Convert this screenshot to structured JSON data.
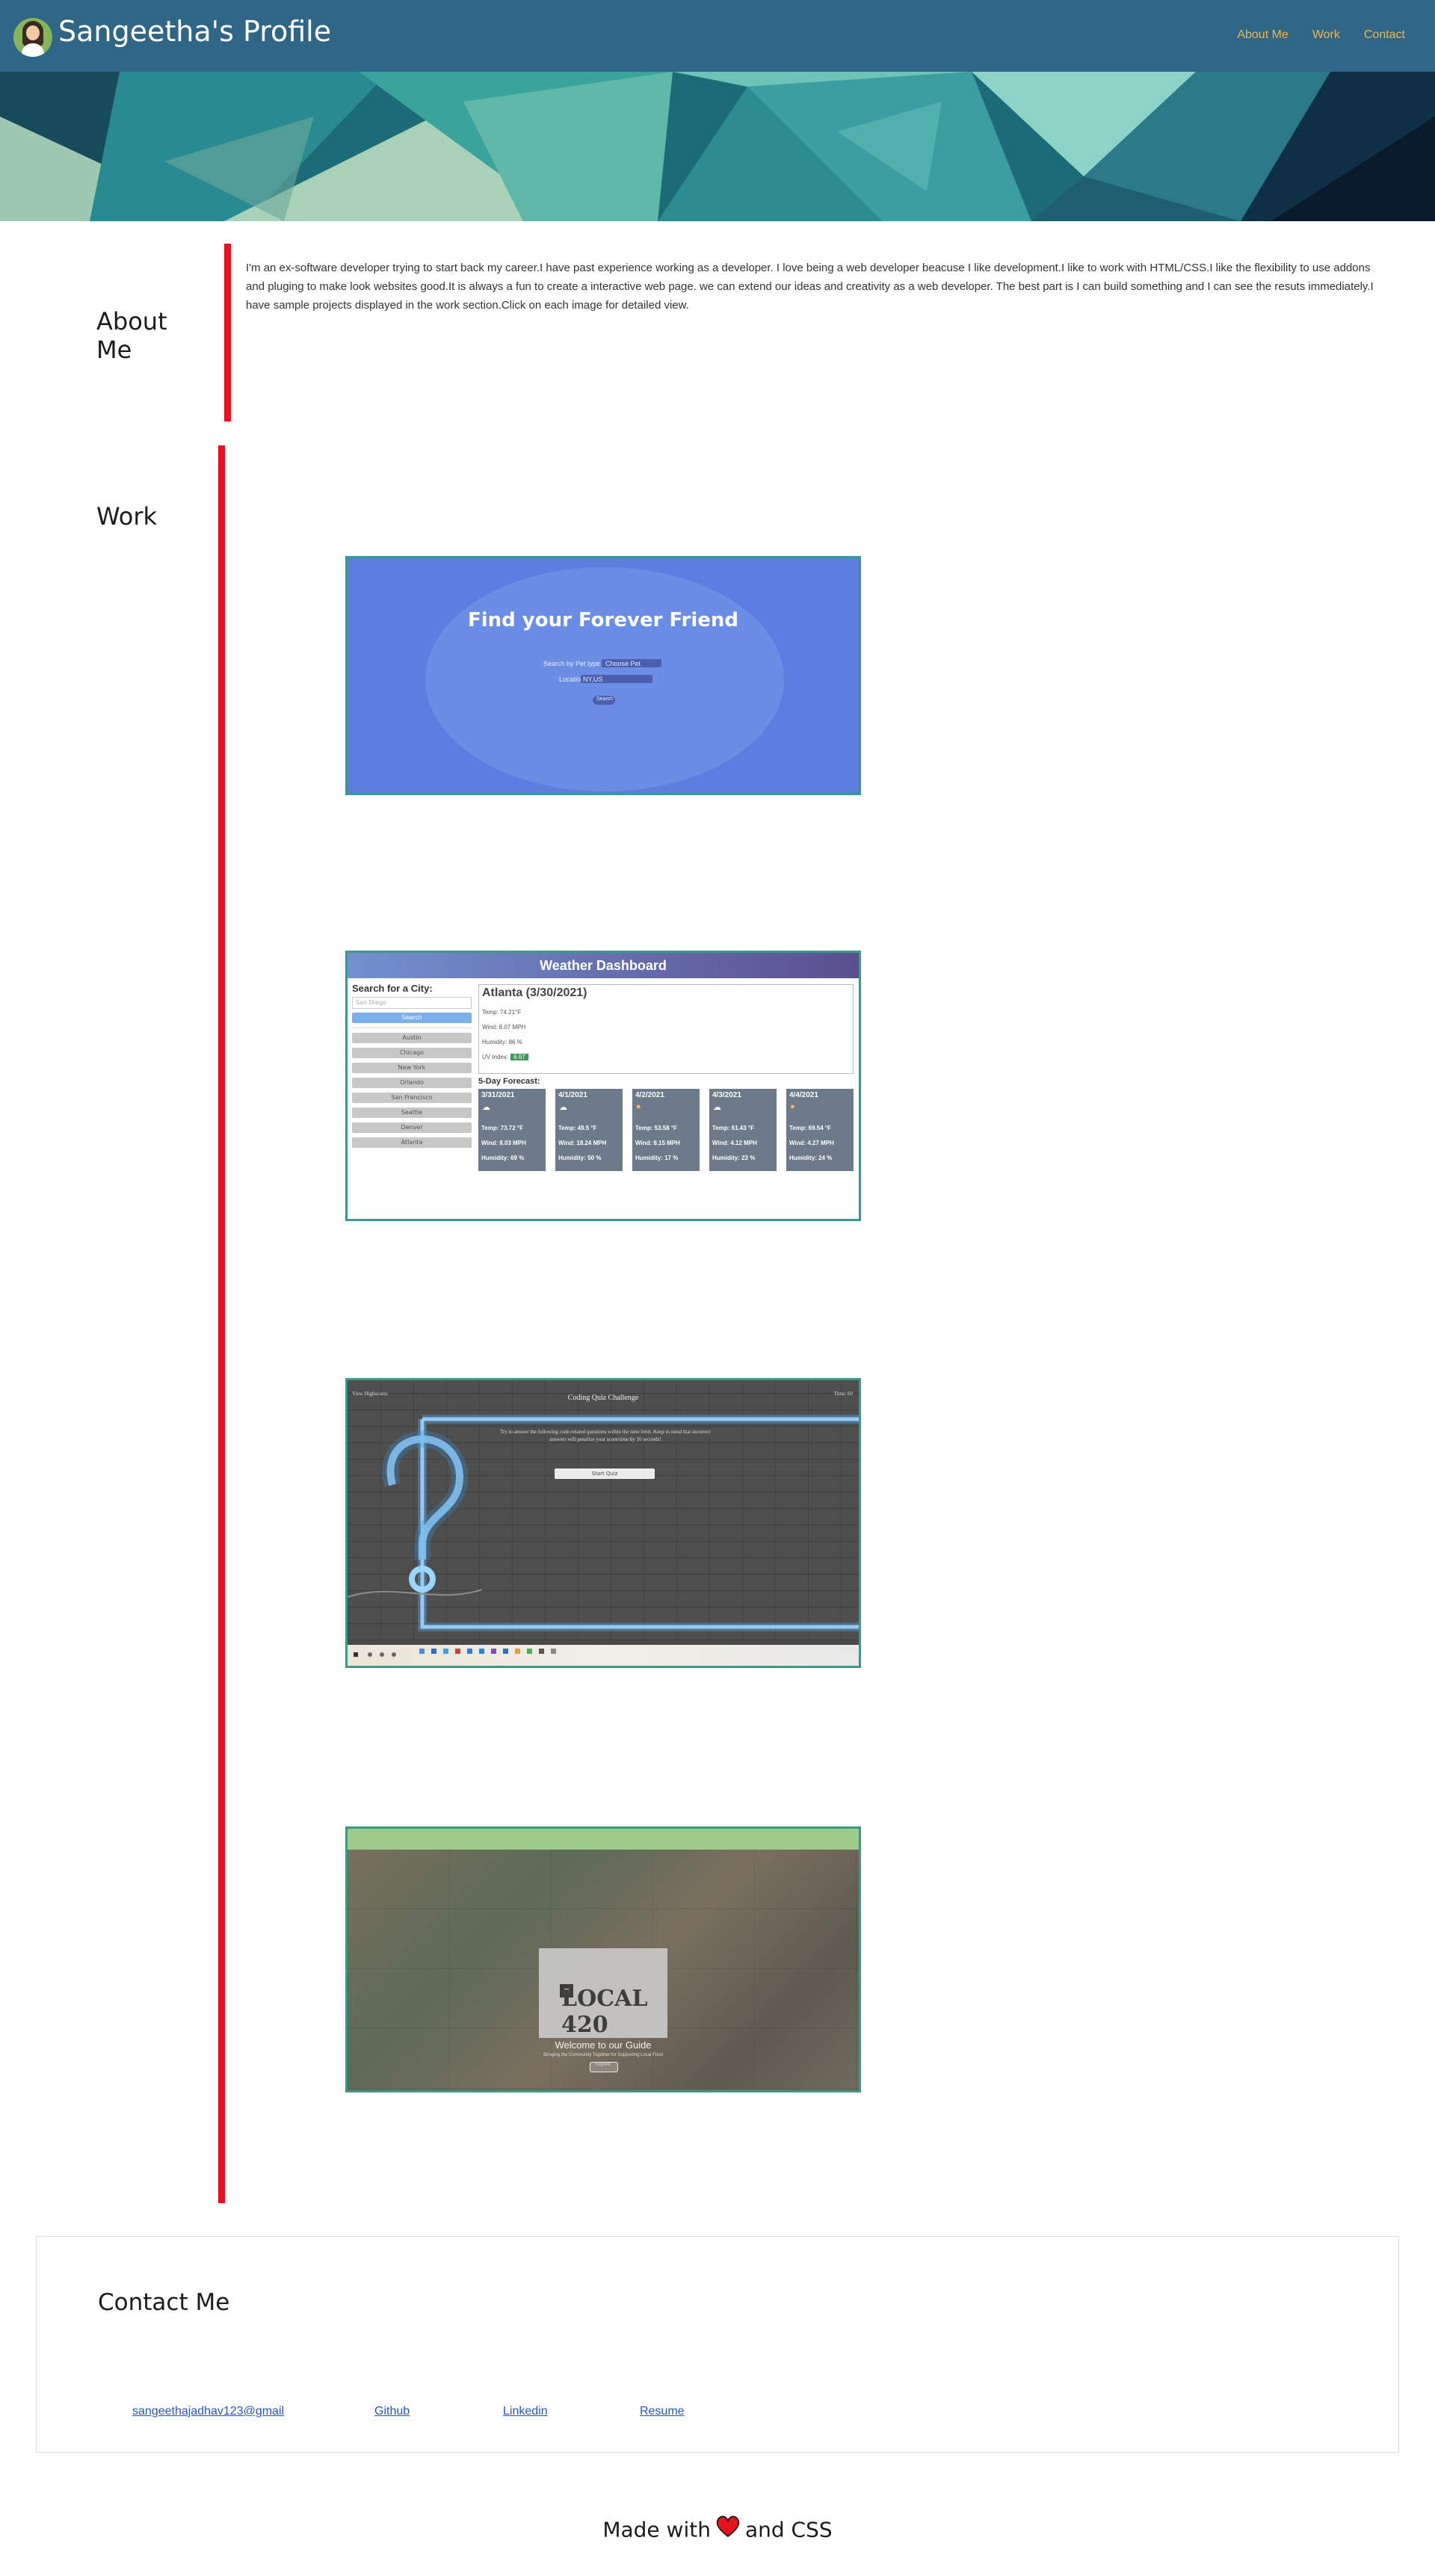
{
  "header": {
    "title": "Sangeetha's Profile",
    "nav": [
      {
        "label": "About Me"
      },
      {
        "label": "Work"
      },
      {
        "label": "Contact"
      }
    ],
    "bg_color": "#2f6686",
    "nav_color": "#f0b64a"
  },
  "about": {
    "heading": "About Me",
    "text": "I'm an ex-software developer trying to start back my career.I have past experience working as a developer. I love being a web developer beacuse I like development.I like to work with HTML/CSS.I like the flexibility to use addons and pluging to make look websites good.It is always a fun to create a interactive web page. we can extend our ideas and creativity as a web developer. The best part is I can build something and I can see the resuts immediately.I have sample projects displayed in the work section.Click on each image for detailed view."
  },
  "work": {
    "heading": "Work",
    "projects": [
      {
        "name": "pet-finder",
        "title": "Find your Forever Friend",
        "fields": [
          "Search by Pet type",
          "Choose Pet",
          "Location",
          "NY,US"
        ],
        "button": "Search"
      },
      {
        "name": "weather-dashboard",
        "title": "Weather Dashboard",
        "search_label": "Search for a City:",
        "search_placeholder": "San Diego",
        "search_button": "Search",
        "cities": [
          "Austin",
          "Chicago",
          "New York",
          "Orlando",
          "San Francisco",
          "Seattle",
          "Denver",
          "Atlanta"
        ],
        "current": {
          "city": "Atlanta (3/30/2021)",
          "temp": "Temp: 74.21°F",
          "wind": "Wind: 8.07 MPH",
          "humidity": "Humidity: 86 %",
          "uv_label": "UV Index:",
          "uv_value": "6.67"
        },
        "forecast_title": "5-Day Forecast:",
        "forecast": [
          {
            "date": "3/31/2021",
            "icon": "rain-cloud-icon",
            "temp": "Temp: 73.72 °F",
            "wind": "Wind: 8.03 MPH",
            "humidity": "Humidity: 69 %"
          },
          {
            "date": "4/1/2021",
            "icon": "rain-cloud-icon",
            "temp": "Temp: 49.5 °F",
            "wind": "Wind: 18.24 MPH",
            "humidity": "Humidity: 50 %"
          },
          {
            "date": "4/2/2021",
            "icon": "sun-icon",
            "temp": "Temp: 53.58 °F",
            "wind": "Wind: 8.15 MPH",
            "humidity": "Humidity: 17 %"
          },
          {
            "date": "4/3/2021",
            "icon": "cloud-icon",
            "temp": "Temp: 61.43 °F",
            "wind": "Wind: 4.12 MPH",
            "humidity": "Humidity: 23 %"
          },
          {
            "date": "4/4/2021",
            "icon": "sun-icon",
            "temp": "Temp: 69.54 °F",
            "wind": "Wind: 4.27 MPH",
            "humidity": "Humidity: 24 %"
          }
        ]
      },
      {
        "name": "coding-quiz",
        "title": "Coding Quiz Challenge",
        "top_left": "View Highscores",
        "top_right": "Time: 60",
        "description": "Try to answer the following code-related questions within the time limit. Keep in mind that incorrect answers will penalize your score/time by 10 seconds!",
        "button": "Start Quiz"
      },
      {
        "name": "local-420",
        "logo": "LOCAL 420",
        "welcome": "Welcome to our Guide",
        "sub": "Bringing the Community Together for Supporting Local Food",
        "button": "Explore"
      }
    ]
  },
  "contact": {
    "heading": "Contact Me",
    "links": [
      {
        "label": "sangeethajadhav123@gmail"
      },
      {
        "label": "Github"
      },
      {
        "label": "Linkedin"
      },
      {
        "label": "Resume"
      }
    ],
    "link_color": "#2455d6"
  },
  "footer": {
    "made_with": "Made with",
    "and_css": "and CSS",
    "heart_icon": "heart-icon"
  },
  "accent_color": "#e8111b"
}
